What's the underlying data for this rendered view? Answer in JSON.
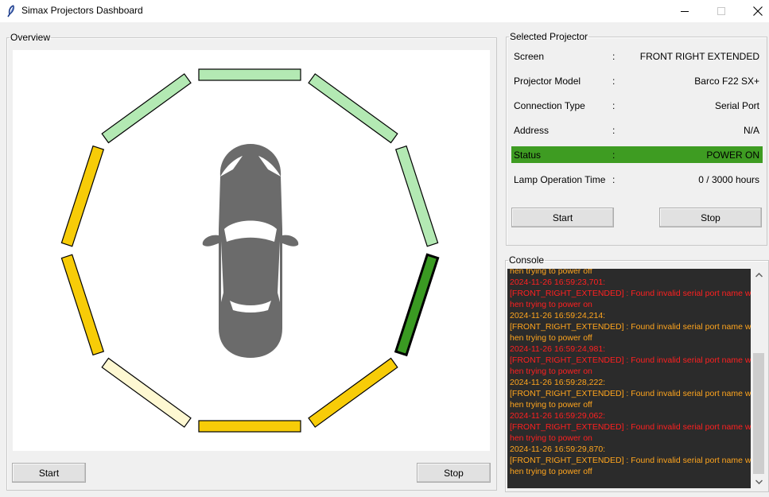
{
  "window": {
    "title": "Simax Projectors Dashboard",
    "icon": "feather-icon",
    "controls": [
      "minimize-icon",
      "maximize-icon",
      "close-icon"
    ]
  },
  "overview": {
    "legend": "Overview",
    "start_label": "Start",
    "stop_label": "Stop",
    "projector_segment_colors": [
      "#b3e9b3",
      "#b3e9b3",
      "#b3e9b3",
      "#3a9a22",
      "#f7cc08",
      "#f7cc08",
      "#fef8d2",
      "#f7cc08",
      "#f7cc08",
      "#b3e9b3"
    ],
    "selected_segment": 3,
    "car_color": "#6b6b6b"
  },
  "selected_projector": {
    "legend": "Selected Projector",
    "rows": [
      {
        "label": "Screen",
        "value": "FRONT RIGHT EXTENDED"
      },
      {
        "label": "Projector Model",
        "value": "Barco F22 SX+"
      },
      {
        "label": "Connection Type",
        "value": "Serial Port"
      },
      {
        "label": "Address",
        "value": "N/A"
      },
      {
        "label": "Status",
        "value": "POWER ON"
      },
      {
        "label": "Lamp Operation Time",
        "value": "0 / 3000 hours"
      }
    ],
    "colon": ":",
    "status_color": "#3e9c22",
    "start_label": "Start",
    "stop_label": "Stop"
  },
  "console": {
    "legend": "Console",
    "lines": [
      {
        "text": "hen trying to power off",
        "color": "orange"
      },
      {
        "text": "2024-11-26 16:59:23,701:",
        "color": "red"
      },
      {
        "text": "[FRONT_RIGHT_EXTENDED] : Found invalid serial port name w",
        "color": "red"
      },
      {
        "text": "hen trying to power on",
        "color": "red"
      },
      {
        "text": "2024-11-26 16:59:24,214:",
        "color": "orange"
      },
      {
        "text": "[FRONT_RIGHT_EXTENDED] : Found invalid serial port name w",
        "color": "orange"
      },
      {
        "text": "hen trying to power off",
        "color": "orange"
      },
      {
        "text": "2024-11-26 16:59:24,981:",
        "color": "red"
      },
      {
        "text": "[FRONT_RIGHT_EXTENDED] : Found invalid serial port name w",
        "color": "red"
      },
      {
        "text": "hen trying to power on",
        "color": "red"
      },
      {
        "text": "2024-11-26 16:59:28,222:",
        "color": "orange"
      },
      {
        "text": "[FRONT_RIGHT_EXTENDED] : Found invalid serial port name w",
        "color": "orange"
      },
      {
        "text": "hen trying to power off",
        "color": "orange"
      },
      {
        "text": "2024-11-26 16:59:29,062:",
        "color": "red"
      },
      {
        "text": "[FRONT_RIGHT_EXTENDED] : Found invalid serial port name w",
        "color": "red"
      },
      {
        "text": "hen trying to power on",
        "color": "red"
      },
      {
        "text": "2024-11-26 16:59:29,870:",
        "color": "orange"
      },
      {
        "text": "[FRONT_RIGHT_EXTENDED] : Found invalid serial port name w",
        "color": "orange"
      },
      {
        "text": "hen trying to power off",
        "color": "orange"
      }
    ]
  }
}
